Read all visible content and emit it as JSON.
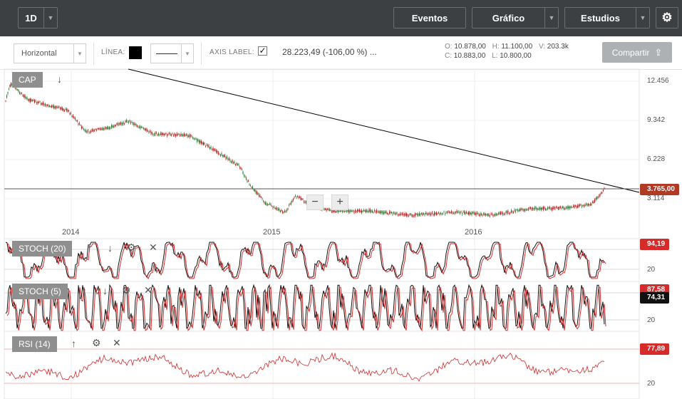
{
  "topbar": {
    "interval": "1D",
    "events": "Eventos",
    "chart": "Gráfico",
    "studies": "Estudios"
  },
  "toolbar": {
    "orientation": "Horizontal",
    "line_label": "LÍNEA:",
    "axis_label": "AXIS LABEL:",
    "axis_checked": "✓",
    "measure": "28.223,49 (-106,00 %) ...",
    "share": "Compartir"
  },
  "ohlc": {
    "o_label": "O:",
    "o": "10.878,00",
    "h_label": "H:",
    "h": "11.100,00",
    "v_label": "V:",
    "v": "203.3k",
    "c_label": "C:",
    "c": "10.883,00",
    "l_label": "L:",
    "l": "10.800,00"
  },
  "main": {
    "symbol": "CAP",
    "y_ticks": [
      "12.456",
      "9.342",
      "6.228",
      "3.114"
    ],
    "x_ticks": [
      "2014",
      "2015",
      "2016"
    ],
    "last_price": "3.765,00",
    "zoom_out": "−",
    "zoom_in": "+"
  },
  "stoch20": {
    "label": "STOCH (20)",
    "value": "94,19",
    "ref": "20"
  },
  "stoch5": {
    "label": "STOCH (5)",
    "value": "87,58",
    "value2": "74,31",
    "ref": "20"
  },
  "rsi": {
    "label": "RSI (14)",
    "value": "77,89",
    "ref": "20"
  },
  "colors": {
    "topbar": "#3c4043",
    "red": "#d52b2b",
    "price_tag": "#b03a24",
    "candle_up": "#2e7d32",
    "candle_down": "#b71c1c"
  }
}
